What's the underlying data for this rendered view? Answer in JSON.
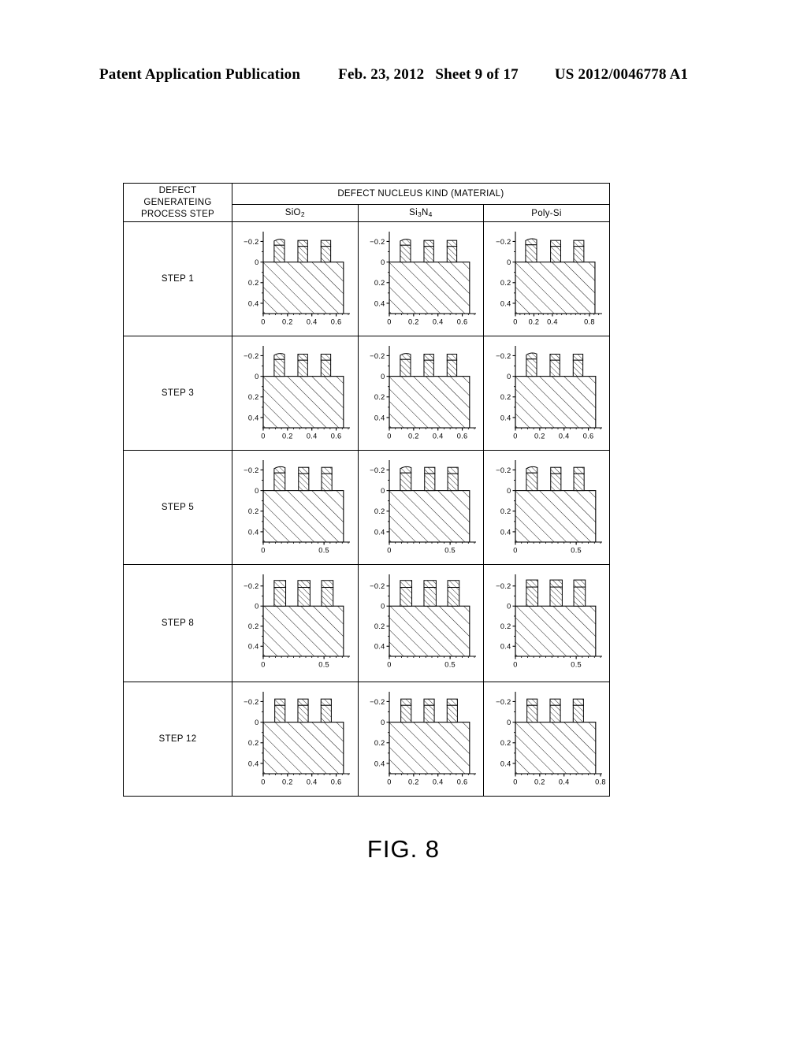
{
  "header": {
    "publication": "Patent Application Publication",
    "date": "Feb. 23, 2012",
    "sheet": "Sheet 9 of 17",
    "number": "US 2012/0046778 A1"
  },
  "table": {
    "row_header_label": "DEFECT GENERATEING PROCESS STEP",
    "row_header_lines": [
      "DEFECT",
      "GENERATEING",
      "PROCESS STEP"
    ],
    "group_header": "DEFECT NUCLEUS KIND (MATERIAL)",
    "columns": [
      {
        "id": "sio2",
        "label_html": "SiO<sub>2</sub>",
        "label": "SiO2"
      },
      {
        "id": "si3n4",
        "label_html": "Si<sub>3</sub>N<sub>4</sub>",
        "label": "Si3N4"
      },
      {
        "id": "polysi",
        "label_html": "Poly-Si",
        "label": "Poly-Si"
      }
    ],
    "rows": [
      {
        "id": "step1",
        "label": "STEP 1"
      },
      {
        "id": "step3",
        "label": "STEP 3"
      },
      {
        "id": "step5",
        "label": "STEP 5"
      },
      {
        "id": "step8",
        "label": "STEP 8"
      },
      {
        "id": "step12",
        "label": "STEP 12"
      }
    ]
  },
  "caption": "FIG. 8",
  "chart_data": [
    {
      "id": "step1-sio2",
      "type": "bar",
      "row": "STEP 1",
      "column": "SiO2",
      "title": "",
      "xlabel": "",
      "ylabel": "",
      "xticks": [
        0,
        0.2,
        0.4,
        0.6
      ],
      "xticklabels": [
        "0",
        "0.2",
        "0.4",
        "0.6"
      ],
      "yticks": [
        -0.2,
        0,
        0.2,
        0.4
      ],
      "yticklabels": [
        "-0.2",
        "0",
        "0.2",
        "0.4"
      ],
      "xlim": [
        0,
        0.7
      ],
      "ylim": [
        -0.28,
        0.5
      ],
      "y_inverted": true,
      "grid": false,
      "substrate": {
        "x0": 0.0,
        "x1": 0.66,
        "y_top": 0.0,
        "y_bottom": 0.5
      },
      "bumps": [
        {
          "x0": 0.09,
          "x1": 0.175,
          "height": -0.225,
          "cap": "arc"
        },
        {
          "x0": 0.285,
          "x1": 0.365,
          "height": -0.21,
          "cap": "flat"
        },
        {
          "x0": 0.475,
          "x1": 0.555,
          "height": -0.21,
          "cap": "flat"
        }
      ]
    },
    {
      "id": "step1-si3n4",
      "type": "bar",
      "row": "STEP 1",
      "column": "Si3N4",
      "title": "",
      "xlabel": "",
      "ylabel": "",
      "xticks": [
        0,
        0.2,
        0.4,
        0.6
      ],
      "xticklabels": [
        "0",
        "0.2",
        "0.4",
        "0.6"
      ],
      "yticks": [
        -0.2,
        0,
        0.2,
        0.4
      ],
      "yticklabels": [
        "-0.2",
        "0",
        "0.2",
        "0.4"
      ],
      "xlim": [
        0,
        0.7
      ],
      "ylim": [
        -0.28,
        0.5
      ],
      "y_inverted": true,
      "grid": false,
      "substrate": {
        "x0": 0.0,
        "x1": 0.66,
        "y_top": 0.0,
        "y_bottom": 0.5
      },
      "bumps": [
        {
          "x0": 0.09,
          "x1": 0.175,
          "height": -0.225,
          "cap": "arc"
        },
        {
          "x0": 0.285,
          "x1": 0.365,
          "height": -0.21,
          "cap": "flat"
        },
        {
          "x0": 0.475,
          "x1": 0.555,
          "height": -0.21,
          "cap": "flat"
        }
      ]
    },
    {
      "id": "step1-polysi",
      "type": "bar",
      "row": "STEP 1",
      "column": "Poly-Si",
      "title": "",
      "xlabel": "",
      "ylabel": "",
      "xticks": [
        0,
        0.2,
        0.4,
        0.8
      ],
      "xticklabels": [
        "0",
        "0.2",
        "0.4",
        "0.8"
      ],
      "yticks": [
        -0.2,
        0,
        0.2,
        0.4
      ],
      "yticklabels": [
        "-0.2",
        "0",
        "0.2",
        "0.4"
      ],
      "xlim": [
        0,
        0.92
      ],
      "ylim": [
        -0.28,
        0.5
      ],
      "y_inverted": true,
      "grid": false,
      "substrate": {
        "x0": 0.0,
        "x1": 0.86,
        "y_top": 0.0,
        "y_bottom": 0.5
      },
      "bumps": [
        {
          "x0": 0.11,
          "x1": 0.23,
          "height": -0.23,
          "cap": "arc"
        },
        {
          "x0": 0.38,
          "x1": 0.49,
          "height": -0.21,
          "cap": "flat"
        },
        {
          "x0": 0.63,
          "x1": 0.74,
          "height": -0.21,
          "cap": "flat"
        }
      ]
    },
    {
      "id": "step3-sio2",
      "type": "bar",
      "row": "STEP 3",
      "column": "SiO2",
      "title": "",
      "xlabel": "",
      "ylabel": "",
      "xticks": [
        0,
        0.2,
        0.4,
        0.6
      ],
      "xticklabels": [
        "0",
        "0.2",
        "0.4",
        "0.6"
      ],
      "yticks": [
        -0.2,
        0,
        0.2,
        0.4
      ],
      "yticklabels": [
        "-0.2",
        "0",
        "0.2",
        "0.4"
      ],
      "xlim": [
        0,
        0.7
      ],
      "ylim": [
        -0.28,
        0.5
      ],
      "y_inverted": true,
      "grid": false,
      "substrate": {
        "x0": 0.0,
        "x1": 0.66,
        "y_top": 0.0,
        "y_bottom": 0.5
      },
      "bumps": [
        {
          "x0": 0.09,
          "x1": 0.175,
          "height": -0.225,
          "cap": "arc"
        },
        {
          "x0": 0.285,
          "x1": 0.365,
          "height": -0.215,
          "cap": "flat"
        },
        {
          "x0": 0.475,
          "x1": 0.555,
          "height": -0.215,
          "cap": "flat"
        }
      ]
    },
    {
      "id": "step3-si3n4",
      "type": "bar",
      "row": "STEP 3",
      "column": "Si3N4",
      "title": "",
      "xlabel": "",
      "ylabel": "",
      "xticks": [
        0,
        0.2,
        0.4,
        0.6
      ],
      "xticklabels": [
        "0",
        "0.2",
        "0.4",
        "0.6"
      ],
      "yticks": [
        -0.2,
        0,
        0.2,
        0.4
      ],
      "yticklabels": [
        "-0.2",
        "0",
        "0.2",
        "0.4"
      ],
      "xlim": [
        0,
        0.7
      ],
      "ylim": [
        -0.28,
        0.5
      ],
      "y_inverted": true,
      "grid": false,
      "substrate": {
        "x0": 0.0,
        "x1": 0.66,
        "y_top": 0.0,
        "y_bottom": 0.5
      },
      "bumps": [
        {
          "x0": 0.09,
          "x1": 0.175,
          "height": -0.225,
          "cap": "arc"
        },
        {
          "x0": 0.285,
          "x1": 0.365,
          "height": -0.215,
          "cap": "flat"
        },
        {
          "x0": 0.475,
          "x1": 0.555,
          "height": -0.215,
          "cap": "flat"
        }
      ]
    },
    {
      "id": "step3-polysi",
      "type": "bar",
      "row": "STEP 3",
      "column": "Poly-Si",
      "title": "",
      "xlabel": "",
      "ylabel": "",
      "xticks": [
        0,
        0.2,
        0.4,
        0.6
      ],
      "xticklabels": [
        "0",
        "0.2",
        "0.4",
        "0.6"
      ],
      "yticks": [
        -0.2,
        0,
        0.2,
        0.4
      ],
      "yticklabels": [
        "-0.2",
        "0",
        "0.2",
        "0.4"
      ],
      "xlim": [
        0,
        0.7
      ],
      "ylim": [
        -0.28,
        0.5
      ],
      "y_inverted": true,
      "grid": false,
      "substrate": {
        "x0": 0.0,
        "x1": 0.66,
        "y_top": 0.0,
        "y_bottom": 0.5
      },
      "bumps": [
        {
          "x0": 0.09,
          "x1": 0.175,
          "height": -0.23,
          "cap": "arc"
        },
        {
          "x0": 0.285,
          "x1": 0.365,
          "height": -0.215,
          "cap": "flat"
        },
        {
          "x0": 0.475,
          "x1": 0.555,
          "height": -0.215,
          "cap": "flat"
        }
      ]
    },
    {
      "id": "step5-sio2",
      "type": "bar",
      "row": "STEP 5",
      "column": "SiO2",
      "title": "",
      "xlabel": "",
      "ylabel": "",
      "xticks": [
        0,
        0.5
      ],
      "xticklabels": [
        "0",
        "0.5"
      ],
      "yticks": [
        -0.2,
        0,
        0.2,
        0.4
      ],
      "yticklabels": [
        "-0.2",
        "0",
        "0.2",
        "0.4"
      ],
      "xlim": [
        0,
        0.7
      ],
      "ylim": [
        -0.28,
        0.5
      ],
      "y_inverted": true,
      "grid": false,
      "substrate": {
        "x0": 0.0,
        "x1": 0.66,
        "y_top": 0.0,
        "y_bottom": 0.5
      },
      "bumps": [
        {
          "x0": 0.09,
          "x1": 0.18,
          "height": -0.235,
          "cap": "arc"
        },
        {
          "x0": 0.29,
          "x1": 0.375,
          "height": -0.225,
          "cap": "flat"
        },
        {
          "x0": 0.48,
          "x1": 0.565,
          "height": -0.225,
          "cap": "flat"
        }
      ]
    },
    {
      "id": "step5-si3n4",
      "type": "bar",
      "row": "STEP 5",
      "column": "Si3N4",
      "title": "",
      "xlabel": "",
      "ylabel": "",
      "xticks": [
        0,
        0.5
      ],
      "xticklabels": [
        "0",
        "0.5"
      ],
      "yticks": [
        -0.2,
        0,
        0.2,
        0.4
      ],
      "yticklabels": [
        "-0.2",
        "0",
        "0.2",
        "0.4"
      ],
      "xlim": [
        0,
        0.7
      ],
      "ylim": [
        -0.28,
        0.5
      ],
      "y_inverted": true,
      "grid": false,
      "substrate": {
        "x0": 0.0,
        "x1": 0.66,
        "y_top": 0.0,
        "y_bottom": 0.5
      },
      "bumps": [
        {
          "x0": 0.09,
          "x1": 0.18,
          "height": -0.235,
          "cap": "arc"
        },
        {
          "x0": 0.29,
          "x1": 0.375,
          "height": -0.225,
          "cap": "flat"
        },
        {
          "x0": 0.48,
          "x1": 0.565,
          "height": -0.225,
          "cap": "flat"
        }
      ]
    },
    {
      "id": "step5-polysi",
      "type": "bar",
      "row": "STEP 5",
      "column": "Poly-Si",
      "title": "",
      "xlabel": "",
      "ylabel": "",
      "xticks": [
        0,
        0.5
      ],
      "xticklabels": [
        "0",
        "0.5"
      ],
      "yticks": [
        -0.2,
        0,
        0.2,
        0.4
      ],
      "yticklabels": [
        "-0.2",
        "0",
        "0.2",
        "0.4"
      ],
      "xlim": [
        0,
        0.7
      ],
      "ylim": [
        -0.28,
        0.5
      ],
      "y_inverted": true,
      "grid": false,
      "substrate": {
        "x0": 0.0,
        "x1": 0.66,
        "y_top": 0.0,
        "y_bottom": 0.5
      },
      "bumps": [
        {
          "x0": 0.09,
          "x1": 0.18,
          "height": -0.235,
          "cap": "arc"
        },
        {
          "x0": 0.29,
          "x1": 0.375,
          "height": -0.225,
          "cap": "flat"
        },
        {
          "x0": 0.48,
          "x1": 0.565,
          "height": -0.225,
          "cap": "flat"
        }
      ]
    },
    {
      "id": "step8-sio2",
      "type": "bar",
      "row": "STEP 8",
      "column": "SiO2",
      "title": "",
      "xlabel": "",
      "ylabel": "",
      "xticks": [
        0,
        0.5
      ],
      "xticklabels": [
        "0",
        "0.5"
      ],
      "yticks": [
        -0.2,
        0,
        0.2,
        0.4
      ],
      "yticklabels": [
        "-0.2",
        "0",
        "0.2",
        "0.4"
      ],
      "xlim": [
        0,
        0.7
      ],
      "ylim": [
        -0.3,
        0.5
      ],
      "y_inverted": true,
      "grid": false,
      "substrate": {
        "x0": 0.0,
        "x1": 0.66,
        "y_top": 0.0,
        "y_bottom": 0.5
      },
      "bumps": [
        {
          "x0": 0.09,
          "x1": 0.185,
          "height": -0.255,
          "cap": "flat"
        },
        {
          "x0": 0.285,
          "x1": 0.385,
          "height": -0.255,
          "cap": "flat"
        },
        {
          "x0": 0.48,
          "x1": 0.575,
          "height": -0.255,
          "cap": "flat"
        }
      ]
    },
    {
      "id": "step8-si3n4",
      "type": "bar",
      "row": "STEP 8",
      "column": "Si3N4",
      "title": "",
      "xlabel": "",
      "ylabel": "",
      "xticks": [
        0,
        0.5
      ],
      "xticklabels": [
        "0",
        "0.5"
      ],
      "yticks": [
        -0.2,
        0,
        0.2,
        0.4
      ],
      "yticklabels": [
        "-0.2",
        "0",
        "0.2",
        "0.4"
      ],
      "xlim": [
        0,
        0.7
      ],
      "ylim": [
        -0.3,
        0.5
      ],
      "y_inverted": true,
      "grid": false,
      "substrate": {
        "x0": 0.0,
        "x1": 0.66,
        "y_top": 0.0,
        "y_bottom": 0.5
      },
      "bumps": [
        {
          "x0": 0.09,
          "x1": 0.185,
          "height": -0.255,
          "cap": "flat"
        },
        {
          "x0": 0.285,
          "x1": 0.385,
          "height": -0.255,
          "cap": "flat"
        },
        {
          "x0": 0.48,
          "x1": 0.575,
          "height": -0.255,
          "cap": "flat"
        }
      ]
    },
    {
      "id": "step8-polysi",
      "type": "bar",
      "row": "STEP 8",
      "column": "Poly-Si",
      "title": "",
      "xlabel": "",
      "ylabel": "",
      "xticks": [
        0,
        0.5
      ],
      "xticklabels": [
        "0",
        "0.5"
      ],
      "yticks": [
        -0.2,
        0,
        0.2,
        0.4
      ],
      "yticklabels": [
        "-0.2",
        "0",
        "0.2",
        "0.4"
      ],
      "xlim": [
        0,
        0.7
      ],
      "ylim": [
        -0.3,
        0.5
      ],
      "y_inverted": true,
      "grid": false,
      "substrate": {
        "x0": 0.0,
        "x1": 0.66,
        "y_top": 0.0,
        "y_bottom": 0.5
      },
      "bumps": [
        {
          "x0": 0.09,
          "x1": 0.185,
          "height": -0.26,
          "cap": "flat"
        },
        {
          "x0": 0.285,
          "x1": 0.385,
          "height": -0.26,
          "cap": "flat"
        },
        {
          "x0": 0.48,
          "x1": 0.575,
          "height": -0.26,
          "cap": "flat"
        }
      ]
    },
    {
      "id": "step12-sio2",
      "type": "bar",
      "row": "STEP 12",
      "column": "SiO2",
      "title": "",
      "xlabel": "",
      "ylabel": "",
      "xticks": [
        0,
        0.2,
        0.4,
        0.6
      ],
      "xticklabels": [
        "0",
        "0.2",
        "0.4",
        "0.6"
      ],
      "yticks": [
        -0.2,
        0,
        0.2,
        0.4
      ],
      "yticklabels": [
        "-0.2",
        "0",
        "0.2",
        "0.4"
      ],
      "xlim": [
        0,
        0.7
      ],
      "ylim": [
        -0.28,
        0.5
      ],
      "y_inverted": true,
      "grid": false,
      "substrate": {
        "x0": 0.0,
        "x1": 0.66,
        "y_top": 0.0,
        "y_bottom": 0.5
      },
      "bumps": [
        {
          "x0": 0.095,
          "x1": 0.18,
          "height": -0.225,
          "cap": "flat"
        },
        {
          "x0": 0.285,
          "x1": 0.37,
          "height": -0.225,
          "cap": "flat"
        },
        {
          "x0": 0.475,
          "x1": 0.56,
          "height": -0.225,
          "cap": "flat"
        }
      ]
    },
    {
      "id": "step12-si3n4",
      "type": "bar",
      "row": "STEP 12",
      "column": "Si3N4",
      "title": "",
      "xlabel": "",
      "ylabel": "",
      "xticks": [
        0,
        0.2,
        0.4,
        0.6
      ],
      "xticklabels": [
        "0",
        "0.2",
        "0.4",
        "0.6"
      ],
      "yticks": [
        -0.2,
        0,
        0.2,
        0.4
      ],
      "yticklabels": [
        "-0.2",
        "0",
        "0.2",
        "0.4"
      ],
      "xlim": [
        0,
        0.7
      ],
      "ylim": [
        -0.28,
        0.5
      ],
      "y_inverted": true,
      "grid": false,
      "substrate": {
        "x0": 0.0,
        "x1": 0.66,
        "y_top": 0.0,
        "y_bottom": 0.5
      },
      "bumps": [
        {
          "x0": 0.095,
          "x1": 0.18,
          "height": -0.225,
          "cap": "flat"
        },
        {
          "x0": 0.285,
          "x1": 0.37,
          "height": -0.225,
          "cap": "flat"
        },
        {
          "x0": 0.475,
          "x1": 0.56,
          "height": -0.225,
          "cap": "flat"
        }
      ]
    },
    {
      "id": "step12-polysi",
      "type": "bar",
      "row": "STEP 12",
      "column": "Poly-Si",
      "title": "",
      "xlabel": "",
      "ylabel": "",
      "xticks": [
        0,
        0.2,
        0.4,
        0.8
      ],
      "xticklabels": [
        "0",
        "0.2",
        "0.4",
        "0.8"
      ],
      "yticks": [
        -0.2,
        0,
        0.2,
        0.4
      ],
      "yticklabels": [
        "-0.2",
        "0",
        "0.2",
        "0.4"
      ],
      "xlim": [
        0,
        0.7
      ],
      "ylim": [
        -0.28,
        0.5
      ],
      "y_inverted": true,
      "grid": false,
      "substrate": {
        "x0": 0.0,
        "x1": 0.66,
        "y_top": 0.0,
        "y_bottom": 0.5
      },
      "bumps": [
        {
          "x0": 0.095,
          "x1": 0.18,
          "height": -0.225,
          "cap": "flat"
        },
        {
          "x0": 0.285,
          "x1": 0.37,
          "height": -0.225,
          "cap": "flat"
        },
        {
          "x0": 0.475,
          "x1": 0.56,
          "height": -0.225,
          "cap": "flat"
        }
      ]
    }
  ]
}
